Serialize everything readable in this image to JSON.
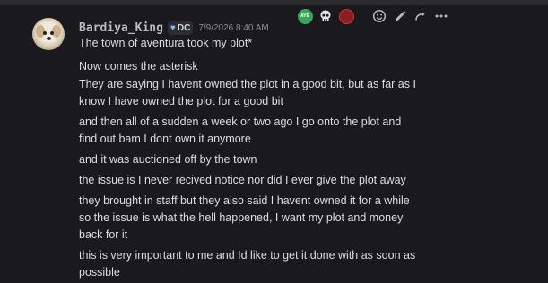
{
  "author": {
    "username": "Bardiya_King",
    "tag": "DC",
    "timestamp": "7/9/2026 8:40 AM"
  },
  "toolbar": {
    "items": [
      "reaction-aye",
      "skull",
      "seal",
      "add-reaction",
      "edit",
      "reply",
      "more"
    ],
    "aye_label": "AYE"
  },
  "message": {
    "lines": [
      "The town of aventura took my plot*",
      "Now comes the asterisk",
      "They are saying I havent owned the plot in a good bit, but as far as I",
      "know I have owned the plot for a good bit",
      "and then all of a sudden a week or two ago I go onto the plot and",
      "find out bam I dont own it anymore",
      "and it was auctioned off by the town",
      "the issue is I never recived notice nor did I ever give the plot away",
      "they brought in staff but they also said I havent owned it for a while",
      "so the issue is what the hell happened, I want my plot and money",
      "back for it",
      "this is very important to me and Id like to get it done with as soon as",
      "possible"
    ]
  },
  "colors": {
    "background": "#1a1a1e",
    "text": "#dbdee1",
    "username": "#b8bcc4",
    "timestamp": "#8a8e96"
  }
}
